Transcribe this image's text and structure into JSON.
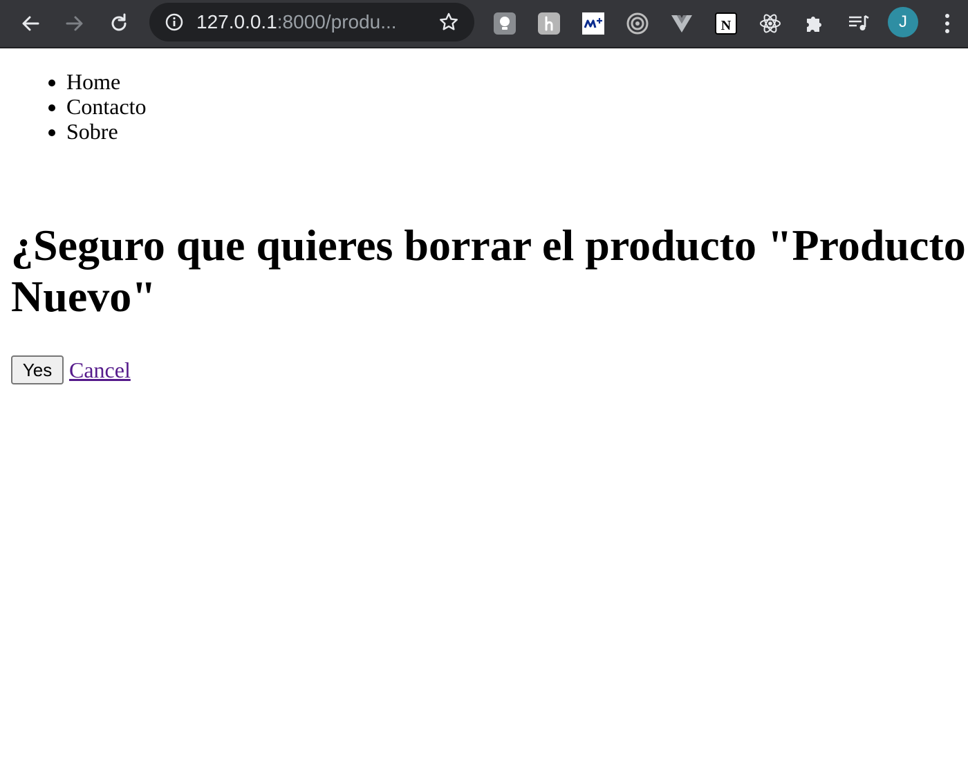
{
  "browser": {
    "url_host": "127.0.0.1",
    "url_rest": ":8000/produ...",
    "profile_initial": "J",
    "extensions": [
      "lightbulb-extension-icon",
      "h-extension-icon",
      "movistar-plus-extension-icon",
      "target-extension-icon",
      "vue-devtools-icon",
      "notion-icon",
      "react-devtools-icon",
      "puzzle-extensions-icon",
      "media-queue-icon"
    ]
  },
  "nav": {
    "items": [
      {
        "label": "Home"
      },
      {
        "label": "Contacto"
      },
      {
        "label": "Sobre"
      }
    ]
  },
  "main": {
    "title": "¿Seguro que quieres borrar el producto \"Producto Nuevo\"",
    "yes_label": "Yes",
    "cancel_label": "Cancel"
  },
  "colors": {
    "chrome_bg": "#35363a",
    "omnibox_bg": "#202124",
    "avatar_bg": "#2e8ea3",
    "visited_link": "#551a8b"
  }
}
